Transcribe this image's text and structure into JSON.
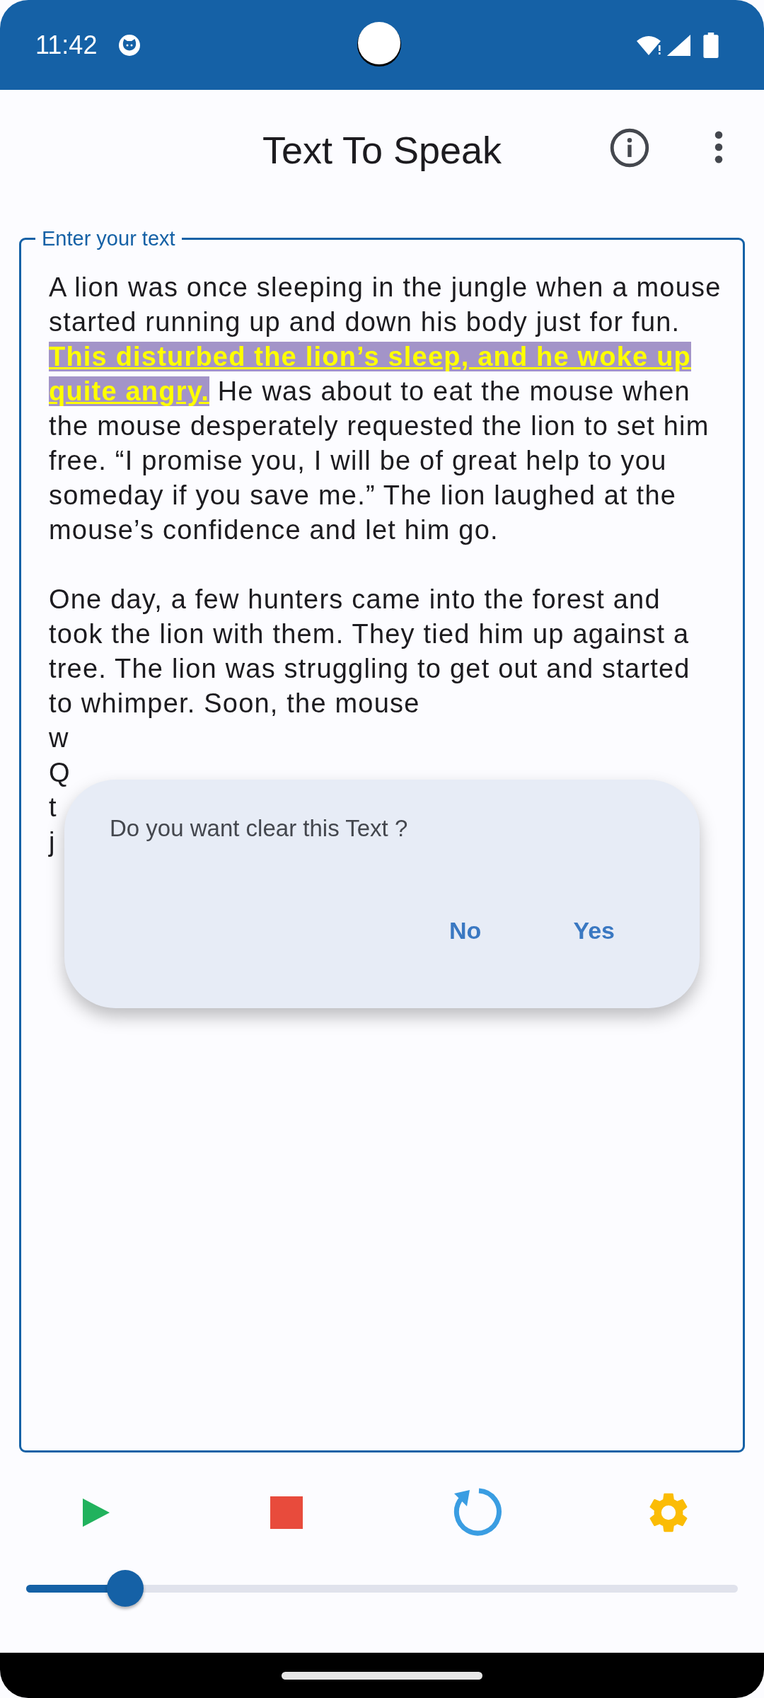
{
  "status_bar": {
    "time": "11:42"
  },
  "app_bar": {
    "title": "Text To Speak"
  },
  "text_field": {
    "label": "Enter your text",
    "paragraphs": [
      "A lion was once sleeping in the jungle when a mouse started running up and down his body just for fun. **This disturbed the lion’s sleep, and he woke up quite angry.** He was about to eat the mouse when the mouse desperately requested the lion to set him free. “I promise you, I will be of great help to you someday if you save me.” The lion laughed at the mouse’s confidence and let him go.",
      "One day, a few hunters came into the forest and took the lion with them. They tied him up against a tree. The lion was struggling to get out and started to whimper. Soon, the mouse"
    ],
    "covered_line_starts": [
      "w",
      "Q",
      "t",
      "j"
    ]
  },
  "dialog": {
    "message": "Do you want clear this Text ?",
    "buttons": [
      "No",
      "Yes"
    ]
  },
  "controls": [
    {
      "kind": "play"
    },
    {
      "kind": "stop"
    },
    {
      "kind": "replay"
    },
    {
      "kind": "settings"
    }
  ],
  "slider": {
    "level": 0.139
  }
}
